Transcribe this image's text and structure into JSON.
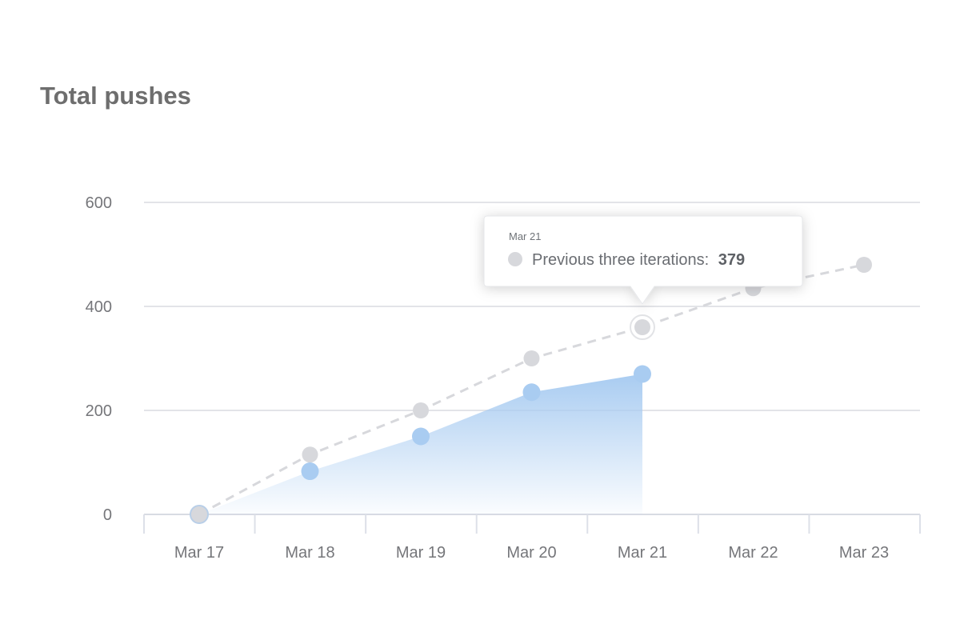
{
  "page": {
    "title": "Total pushes"
  },
  "colors": {
    "current_series": "#a9ccf1",
    "previous_series": "#d7d8dc",
    "gridline": "#e3e4e8",
    "axis_text": "#75767a",
    "title_text": "#6e6e6e"
  },
  "tooltip": {
    "date": "Mar 21",
    "series_label": "Previous three iterations:",
    "value": "379"
  },
  "chart_data": {
    "type": "area",
    "title": "Total pushes",
    "categories": [
      "Mar 17",
      "Mar 18",
      "Mar 19",
      "Mar 20",
      "Mar 21",
      "Mar 22",
      "Mar 23"
    ],
    "y_ticks": [
      "0",
      "200",
      "400",
      "600"
    ],
    "ylim": [
      0,
      600
    ],
    "grid": true,
    "series": [
      {
        "name": "",
        "style": "filled-area",
        "values": [
          0,
          83,
          150,
          235,
          270,
          null,
          null
        ]
      },
      {
        "name": "Previous three iterations",
        "style": "dashed-line",
        "values": [
          0,
          115,
          200,
          300,
          360,
          435,
          480
        ]
      }
    ],
    "highlight": {
      "category": "Mar 21",
      "series": "Previous three iterations",
      "value": 379
    }
  }
}
